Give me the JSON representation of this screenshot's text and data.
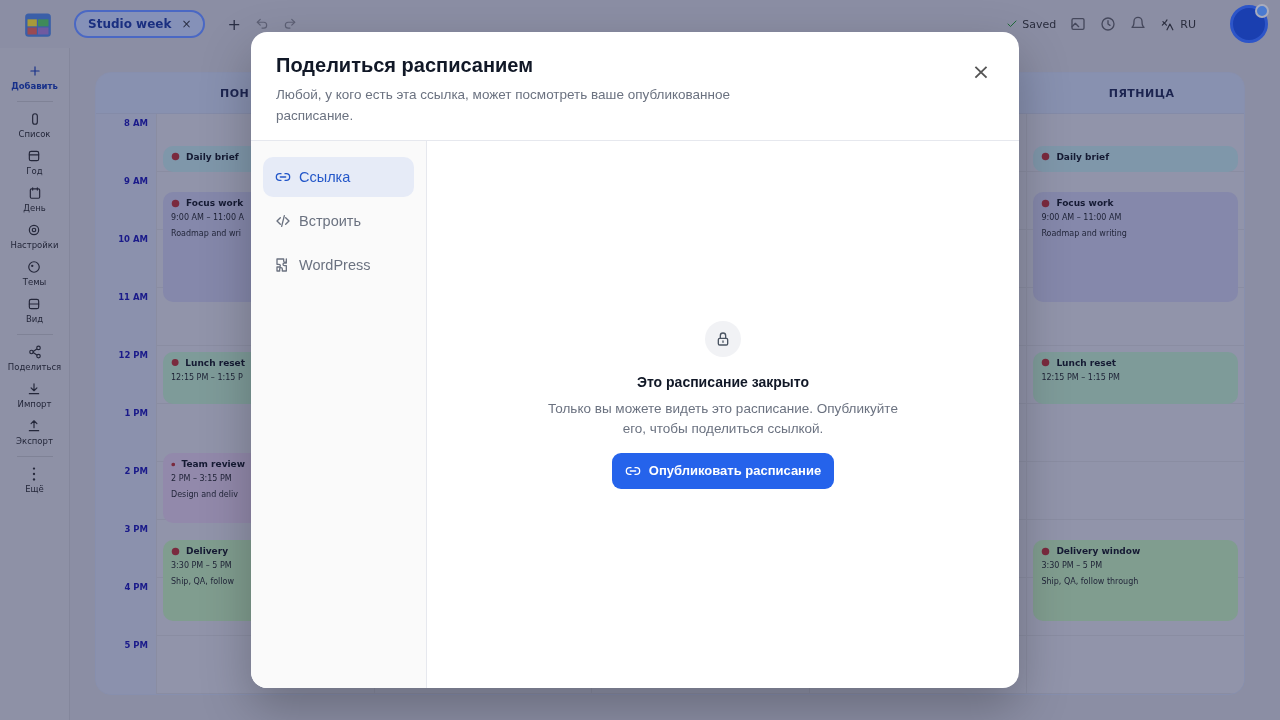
{
  "topbar": {
    "tab": {
      "label": "Studio week",
      "close": "×"
    },
    "add": "+",
    "saved": "Saved",
    "language": "RU"
  },
  "sidebar": {
    "items": [
      {
        "label": "Добавить",
        "kind": "primary"
      },
      {
        "label": "Список",
        "kind": "plain"
      },
      {
        "label": "Год",
        "kind": "plain"
      },
      {
        "label": "День",
        "kind": "plain"
      },
      {
        "label": "Настройки",
        "kind": "plain"
      },
      {
        "label": "Темы",
        "kind": "plain"
      },
      {
        "label": "Вид",
        "kind": "plain"
      },
      {
        "label": "Поделиться",
        "kind": "plain"
      },
      {
        "label": "Импорт",
        "kind": "plain"
      },
      {
        "label": "Экспорт",
        "kind": "plain"
      },
      {
        "label": "Ещё",
        "kind": "plain"
      }
    ]
  },
  "calendar": {
    "times": [
      "8 AM",
      "9 AM",
      "10 AM",
      "11 AM",
      "12 PM",
      "1 PM",
      "2 PM",
      "3 PM",
      "4 PM",
      "5 PM"
    ],
    "days": [
      {
        "name": "ПОН",
        "events": [
          {
            "title": "Daily brief",
            "color": "#7f97aa"
          },
          {
            "title": "Focus work",
            "time": "9:00 AM – 11:00 A",
            "note": "Roadmap and wri",
            "color": "#8588ab"
          },
          {
            "title": "Lunch reset",
            "time": "12:15 PM – 1:15 P",
            "color": "#7e9b99"
          },
          {
            "title": "Team review",
            "time": "2 PM – 3:15 PM",
            "note": "Design and deliv",
            "color": "#9289ab"
          },
          {
            "title": "Delivery",
            "time": "3:30 PM – 5 PM",
            "note": "Ship, QA, follow",
            "color": "#809d8f"
          }
        ]
      },
      {
        "name": "ПЯТНИЦА",
        "events": [
          {
            "title": "Daily brief",
            "color": "#7f97aa"
          },
          {
            "title": "Focus work",
            "time": "9:00 AM – 11:00 AM",
            "note": "Roadmap and writing",
            "color": "#8588ab"
          },
          {
            "title": "Lunch reset",
            "time": "12:15 PM – 1:15 PM",
            "color": "#7e9b99"
          },
          {
            "title": "Delivery window",
            "time": "3:30 PM – 5 PM",
            "note": "Ship, QA, follow through",
            "color": "#809d8f"
          }
        ]
      }
    ]
  },
  "dialog": {
    "title": "Поделиться расписанием",
    "subtitle": "Любой, у кого есть эта ссылка, может посмотреть ваше опубликованное расписание.",
    "close": "×",
    "tabs": [
      {
        "label": "Ссылка",
        "kind": "link",
        "selected": true
      },
      {
        "label": "Встроить",
        "kind": "code",
        "selected": false
      },
      {
        "label": "WordPress",
        "kind": "plugin",
        "selected": false
      }
    ],
    "empty": {
      "title": "Это расписание закрыто",
      "text": "Только вы можете видеть это расписание. Опубликуйте его, чтобы поделиться ссылкой.",
      "button": "Опубликовать расписание"
    }
  }
}
